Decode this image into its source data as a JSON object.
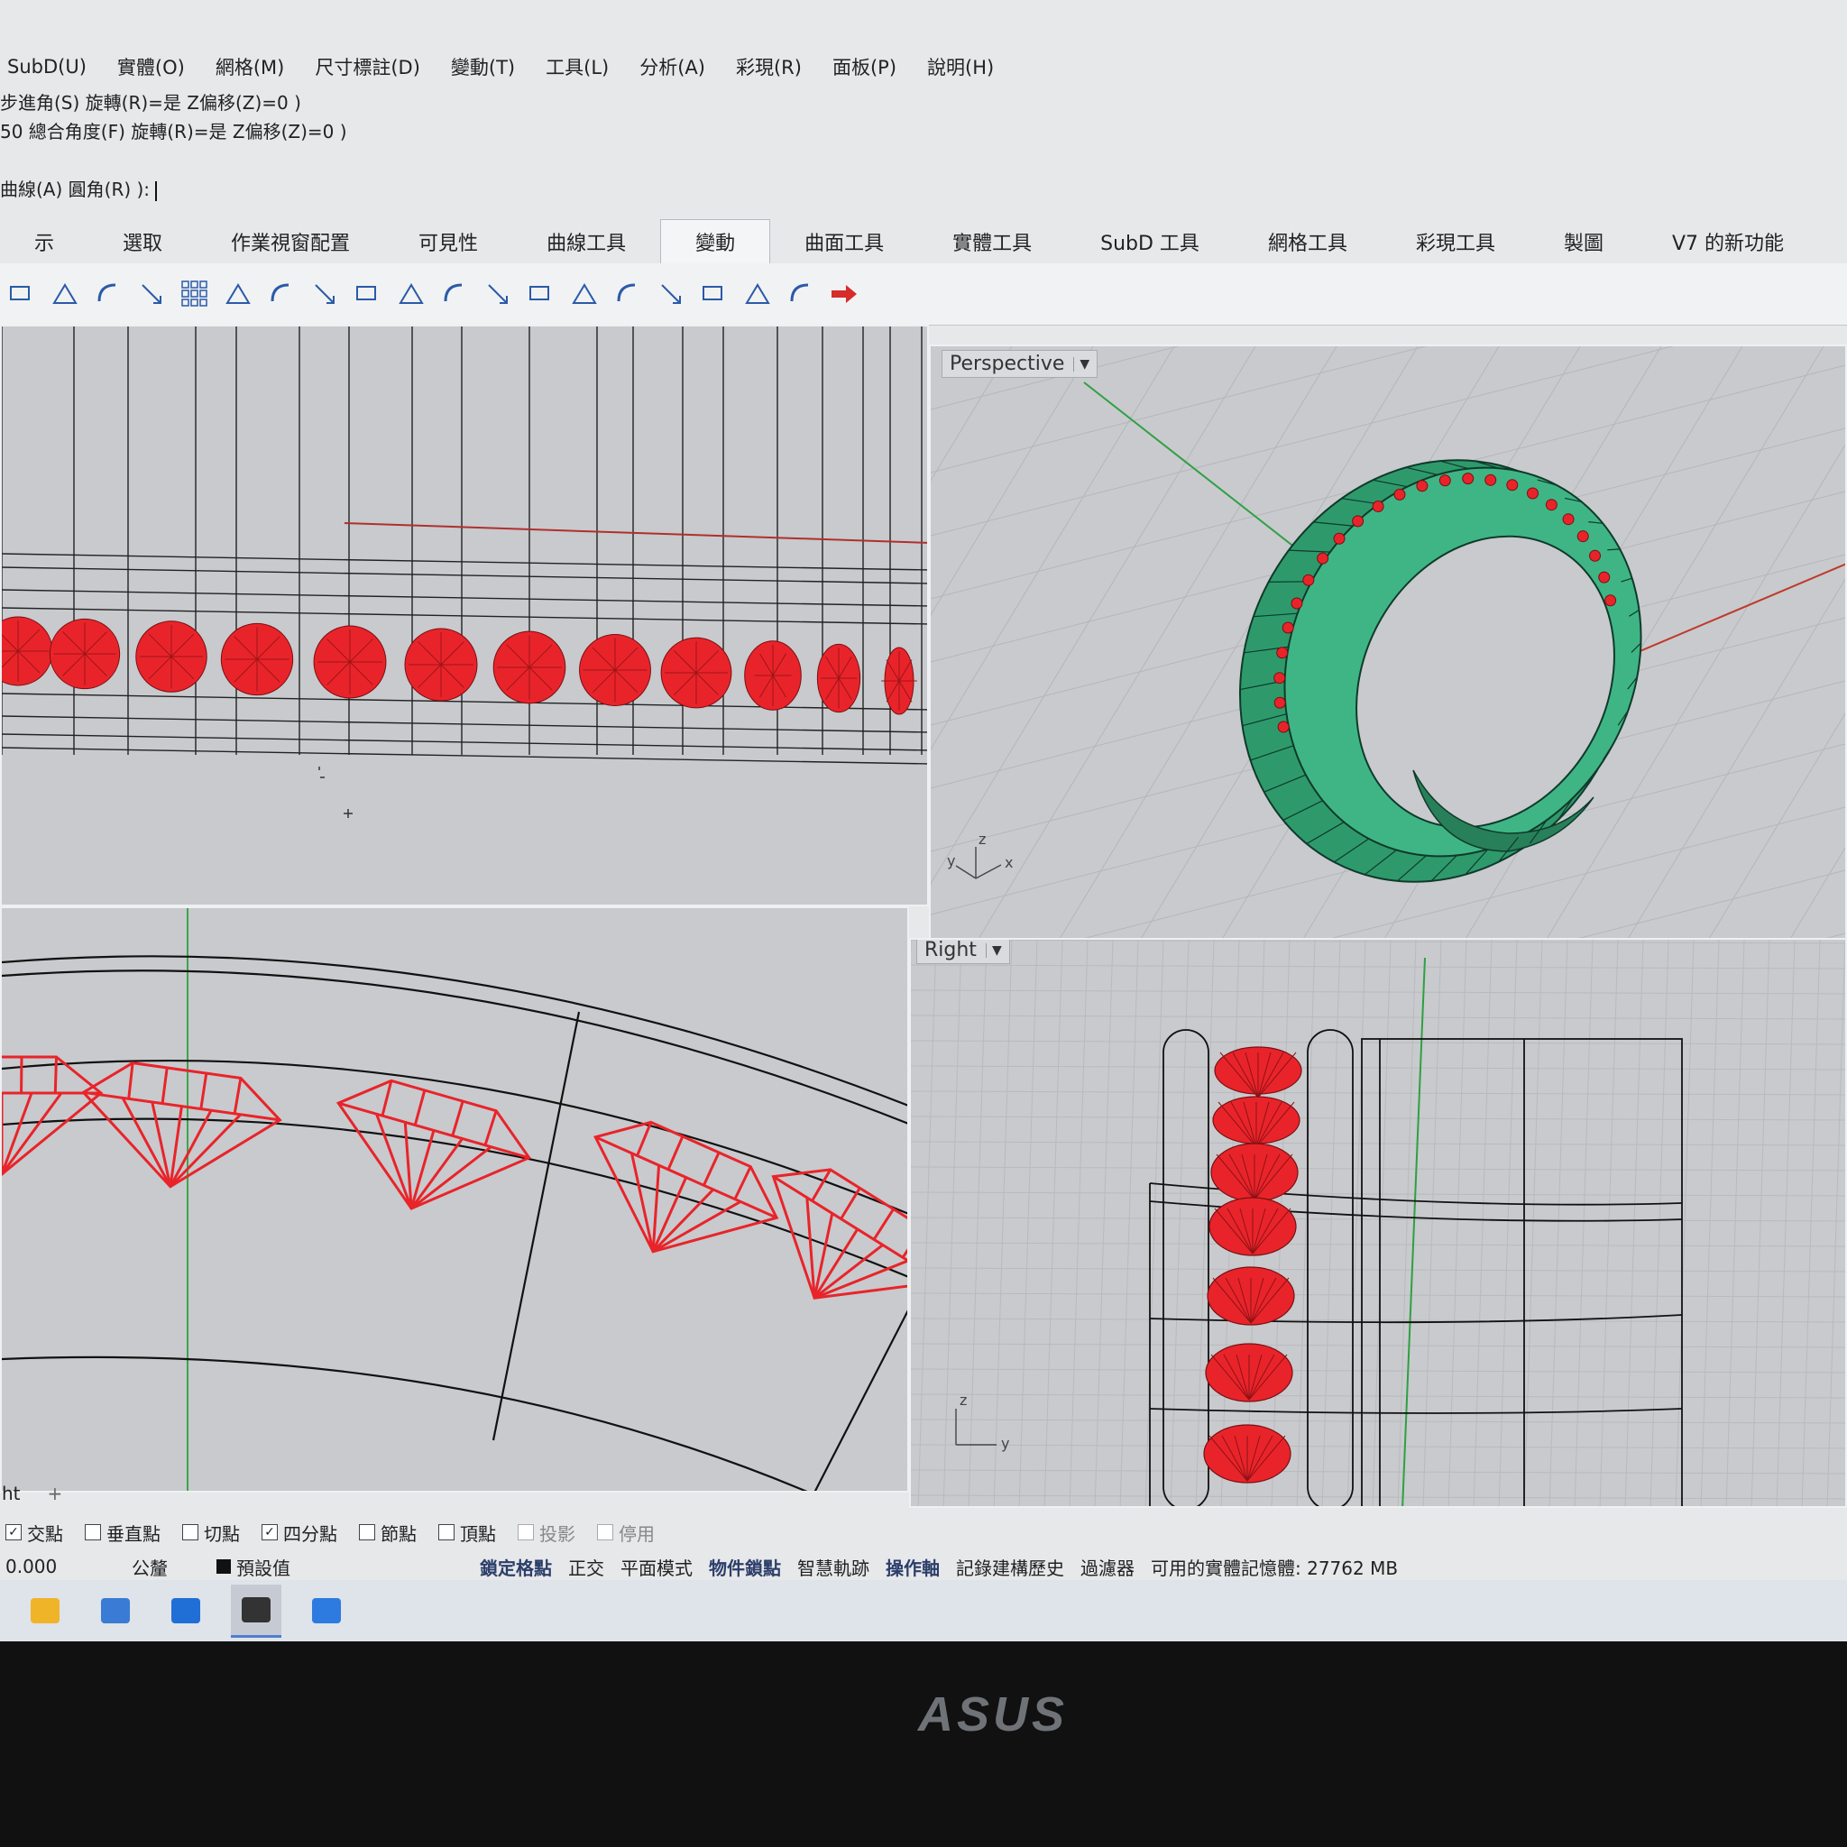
{
  "menu": [
    "SubD(U)",
    "實體(O)",
    "網格(M)",
    "尺寸標註(D)",
    "變動(T)",
    "工具(L)",
    "分析(A)",
    "彩現(R)",
    "面板(P)",
    "說明(H)"
  ],
  "command": {
    "line1": "步進角(S)  旋轉(R)=是  Z偏移(Z)=0 )",
    "line2": "50  總合角度(F)  旋轉(R)=是  Z偏移(Z)=0 )",
    "prompt": "曲線(A)  圓角(R) ):"
  },
  "tabs": [
    "示",
    "選取",
    "作業視窗配置",
    "可見性",
    "曲線工具",
    "變動",
    "曲面工具",
    "實體工具",
    "SubD 工具",
    "網格工具",
    "彩現工具",
    "製圖",
    "V7 的新功能"
  ],
  "active_tab": "變動",
  "toolbar_icons": [
    "move-icon",
    "copy-icon",
    "rotate-icon",
    "scale-icon",
    "array-icon",
    "polar-array-icon",
    "orient-icon",
    "array-curve-icon",
    "align-icon",
    "mirror-icon",
    "bend-icon",
    "taper-icon",
    "shear-icon",
    "twist-icon",
    "flow-icon",
    "cage-edit-icon",
    "flow-surface-icon",
    "project-icon",
    "extrude-icon",
    "arrow-red-icon"
  ],
  "viewports": {
    "perspective": {
      "label": "Perspective",
      "axes": {
        "x": "x",
        "y": "y",
        "z": "z"
      }
    },
    "right": {
      "label": "Right",
      "axes": {
        "y": "y",
        "z": "z"
      }
    },
    "bottom_left_tab": "ht",
    "add_tab": "+"
  },
  "osnaps": [
    {
      "label": "交點",
      "checked": true,
      "enabled": true
    },
    {
      "label": "垂直點",
      "checked": false,
      "enabled": true
    },
    {
      "label": "切點",
      "checked": false,
      "enabled": true
    },
    {
      "label": "四分點",
      "checked": true,
      "enabled": true
    },
    {
      "label": "節點",
      "checked": false,
      "enabled": true
    },
    {
      "label": "頂點",
      "checked": false,
      "enabled": true
    },
    {
      "label": "投影",
      "checked": false,
      "enabled": false
    },
    {
      "label": "停用",
      "checked": false,
      "enabled": false
    }
  ],
  "status": {
    "coord": "0.000",
    "unit": "公釐",
    "layer": "預設值",
    "panes": [
      {
        "label": "鎖定格點",
        "bold": true
      },
      {
        "label": "正交",
        "bold": false
      },
      {
        "label": "平面模式",
        "bold": false
      },
      {
        "label": "物件鎖點",
        "bold": true
      },
      {
        "label": "智慧軌跡",
        "bold": false
      },
      {
        "label": "操作軸",
        "bold": true
      },
      {
        "label": "記錄建構歷史",
        "bold": false
      },
      {
        "label": "過濾器",
        "bold": false
      }
    ],
    "memory": "可用的實體記憶體: 27762 MB"
  },
  "taskbar_icons": [
    "file-explorer-icon",
    "store-icon",
    "mail-icon",
    "rhino-icon",
    "photos-icon"
  ],
  "monitor_brand": "ASUS",
  "colors": {
    "gem": "#e8242a",
    "ring": "#2e9a6c",
    "viewport_bg": "#c8cacd",
    "x_axis": "#c0392b",
    "y_axis": "#2ea043"
  }
}
